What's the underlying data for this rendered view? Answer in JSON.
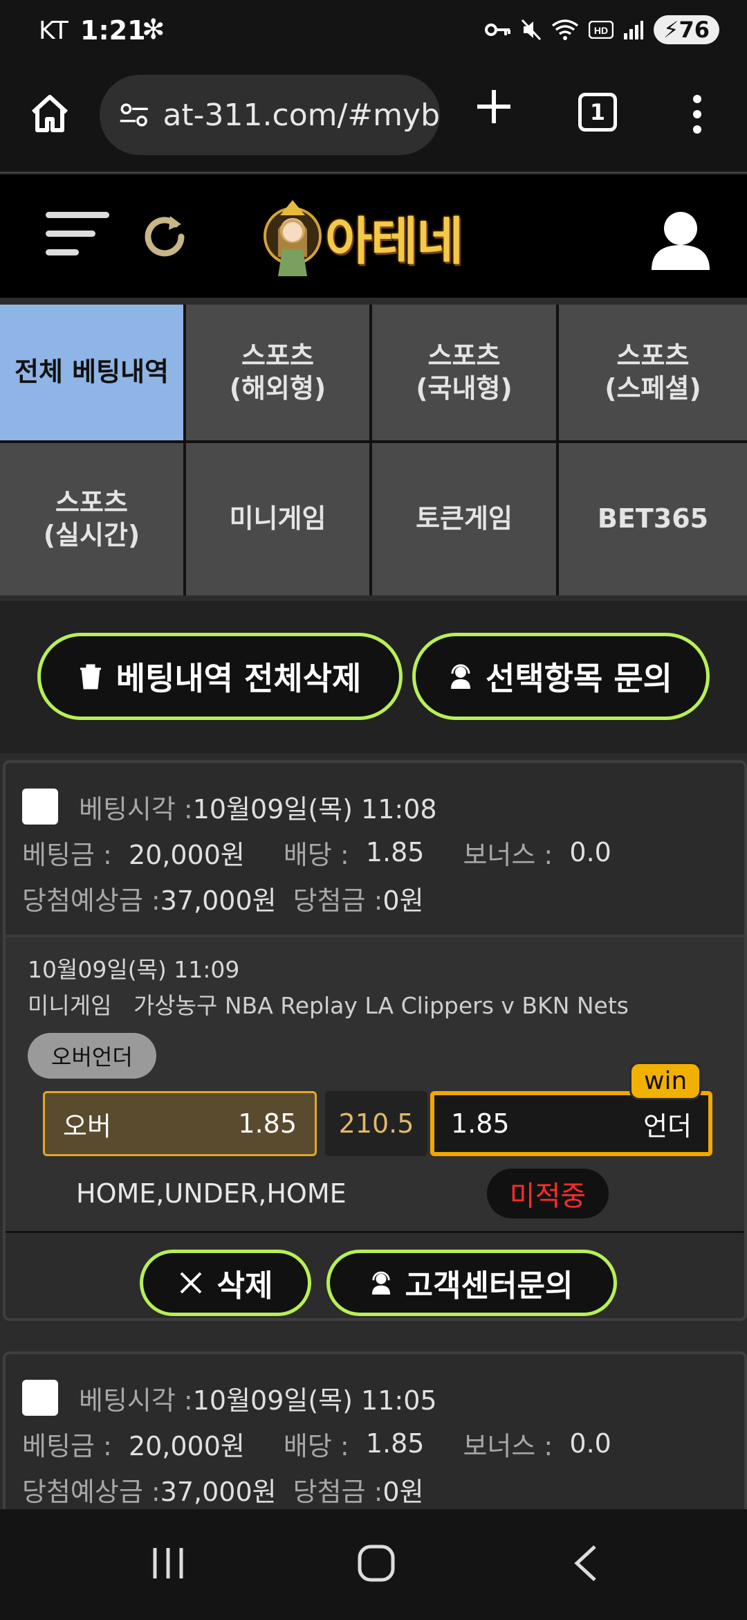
{
  "status_bar": {
    "carrier": "KT",
    "time": "1:21",
    "battery": "76"
  },
  "browser": {
    "url": "at-311.com/#myb",
    "tab_count": "1"
  },
  "header": {
    "logo_text": "아테네"
  },
  "categories": [
    {
      "label": "전체 베팅내역",
      "active": true
    },
    {
      "label": "스포츠\n(해외형)"
    },
    {
      "label": "스포츠\n(국내형)"
    },
    {
      "label": "스포츠\n(스페셜)"
    },
    {
      "label": "스포츠\n(실시간)"
    },
    {
      "label": "미니게임"
    },
    {
      "label": "토큰게임"
    },
    {
      "label": "BET365"
    }
  ],
  "actions": {
    "delete_all": "베팅내역 전체삭제",
    "inquiry_selected": "선택항목 문의"
  },
  "labels": {
    "bet_time": "베팅시각 :",
    "bet_amount": "베팅금 :",
    "odds": "배당 :",
    "bonus": "보너스 :",
    "expected_win": "당첨예상금 :",
    "win_amount": "당첨금 :",
    "delete": "삭제",
    "support": "고객센터문의"
  },
  "bets": [
    {
      "time": "10월09일(목) 11:08",
      "amount": "20,000원",
      "odds": "1.85",
      "bonus": "0.0",
      "expected": "37,000원",
      "won": "0원",
      "game": {
        "date": "10월09일(목) 11:09",
        "category": "미니게임",
        "title": "가상농구 NBA Replay LA Clippers v BKN Nets",
        "market": "오버언더",
        "over_label": "오버",
        "over_odds": "1.85",
        "line": "210.5",
        "under_odds": "1.85",
        "under_label": "언더",
        "badge": "win",
        "result": "HOME,UNDER,HOME",
        "status": "미적중"
      }
    },
    {
      "time": "10월09일(목) 11:05",
      "amount": "20,000원",
      "odds": "1.85",
      "bonus": "0.0",
      "expected": "37,000원",
      "won": "0원"
    }
  ],
  "colors": {
    "accent_green": "#b7f055",
    "win_gold": "#f2b000",
    "active_tab": "#8fb5e6",
    "miss_red": "#ff2b2b"
  }
}
